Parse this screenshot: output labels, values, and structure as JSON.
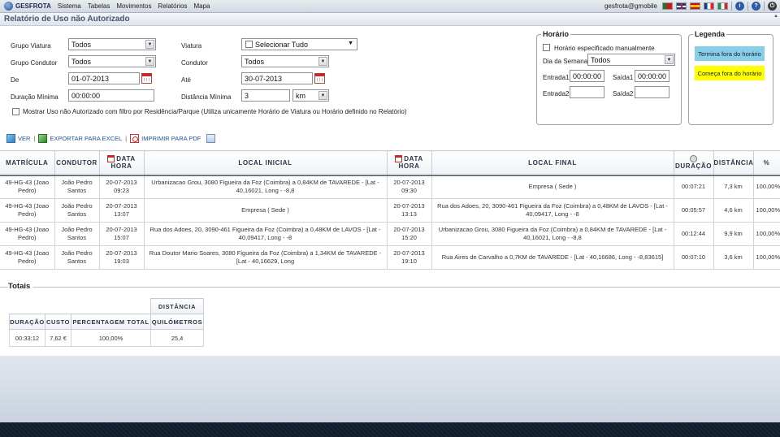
{
  "topbar": {
    "brand": "GESFROTA",
    "menu": [
      "Sistema",
      "Tabelas",
      "Movimentos",
      "Relatórios",
      "Mapa"
    ],
    "user": "gesfrota@gmobile",
    "info_icon": "i",
    "help_icon": "?"
  },
  "page": {
    "title": "Relatório de Uso não Autorizado"
  },
  "filters": {
    "grupo_viatura": {
      "label": "Grupo Viatura",
      "value": "Todos"
    },
    "grupo_condutor": {
      "label": "Grupo Condutor",
      "value": "Todos"
    },
    "de": {
      "label": "De",
      "value": "01-07-2013"
    },
    "duracao_minima": {
      "label": "Duração Mínima",
      "value": "00:00:00"
    },
    "viatura": {
      "label": "Viatura",
      "value": "Selecionar Tudo"
    },
    "condutor": {
      "label": "Condutor",
      "value": "Todos"
    },
    "ate": {
      "label": "Até",
      "value": "30-07-2013"
    },
    "distancia_minima": {
      "label": "Distância Mínima",
      "value": "3",
      "unit": "km"
    },
    "mostrar_uso": "Mostrar Uso não Autorizado com filtro por Residência/Parque (Utiliza unicamente Horário de Viatura ou Horário definido no Relatório)"
  },
  "horario": {
    "legend": "Horário",
    "manual": "Horário especificado manualmente",
    "dia_semana_label": "Dia da Semana",
    "dia_semana_value": "Todos",
    "entrada1_label": "Entrada1",
    "entrada1_value": "00:00:00",
    "saida1_label": "Saída1",
    "saida1_value": "00:00:00",
    "entrada2_label": "Entrada2",
    "entrada2_value": "",
    "saida2_label": "Saída2",
    "saida2_value": ""
  },
  "legenda": {
    "title": "Legenda",
    "items": [
      {
        "label": "Termina fora do horário",
        "color": "#87ceeb"
      },
      {
        "label": "Começa fora do horário",
        "color": "#ffff00"
      }
    ]
  },
  "toolbar": {
    "ver": "VER",
    "exportar": "EXPORTAR PARA EXCEL",
    "imprimir": "IMPRIMIR PARA PDF"
  },
  "table": {
    "headers": {
      "matricula": "MATRÍCULA",
      "condutor": "CONDUTOR",
      "data_hora_1": "DATA",
      "data_hora_2": "HORA",
      "local_inicial": "LOCAL INICIAL",
      "data_hora_fim_1": "DATA",
      "data_hora_fim_2": "HORA",
      "local_final": "LOCAL FINAL",
      "duracao": "DURAÇÃO",
      "distancia": "DISTÂNCIA",
      "percent": "%"
    },
    "rows": [
      {
        "matricula": "49-HG-43 (Joao Pedro)",
        "condutor": "João Pedro Santos",
        "inicio": "20-07-2013 09:23",
        "local_inicial": "Urbanizacao Grou, 3080 Figueira da Foz (Coimbra) a 0,84KM de TAVAREDE - [Lat - 40,16021, Long - -8,8",
        "fim": "20-07-2013 09:30",
        "local_final": "Empresa ( Sede )",
        "duracao": "00:07:21",
        "distancia": "7,3 km",
        "percent": "100,00%"
      },
      {
        "matricula": "49-HG-43 (Joao Pedro)",
        "condutor": "João Pedro Santos",
        "inicio": "20-07-2013 13:07",
        "local_inicial": "Empresa ( Sede )",
        "fim": "20-07-2013 13:13",
        "local_final": "Rua dos Adoes, 20, 3090-461 Figueira da Foz (Coimbra) a 0,48KM de LAVOS - [Lat - 40,09417, Long - -8",
        "duracao": "00:05:57",
        "distancia": "4,6 km",
        "percent": "100,00%"
      },
      {
        "matricula": "49-HG-43 (Joao Pedro)",
        "condutor": "João Pedro Santos",
        "inicio": "20-07-2013 15:07",
        "local_inicial": "Rua dos Adoes, 20, 3090-461 Figueira da Foz (Coimbra) a 0,48KM de LAVOS - [Lat - 40,09417, Long - -8",
        "fim": "20-07-2013 15:20",
        "local_final": "Urbanizacao Grou, 3080 Figueira da Foz (Coimbra) a 0,84KM de TAVAREDE - [Lat - 40,16021, Long - -8,8",
        "duracao": "00:12:44",
        "distancia": "9,9 km",
        "percent": "100,00%"
      },
      {
        "matricula": "49-HG-43 (Joao Pedro)",
        "condutor": "João Pedro Santos",
        "inicio": "20-07-2013 19:03",
        "local_inicial": "Rua Doutor Mario Soares, 3080 Figueira da Foz (Coimbra) a 1,34KM de TAVAREDE - [Lat - 40,16629, Long",
        "fim": "20-07-2013 19:10",
        "local_final": "Rua Aires de Carvalho a 0,7KM de TAVAREDE - [Lat - 40,16686, Long - -8,83615]",
        "duracao": "00:07:10",
        "distancia": "3,6 km",
        "percent": "100,00%"
      }
    ]
  },
  "totals": {
    "title": "Totais",
    "distancia_group": "DISTÂNCIA",
    "headers": {
      "duracao": "DURAÇÃO",
      "custo": "CUSTO",
      "percentagem": "PERCENTAGEM TOTAL",
      "quilometros": "QUILÓMETROS"
    },
    "values": {
      "duracao": "00:33:12",
      "custo": "7,62 €",
      "percentagem": "100,00%",
      "quilometros": "25,4"
    }
  }
}
